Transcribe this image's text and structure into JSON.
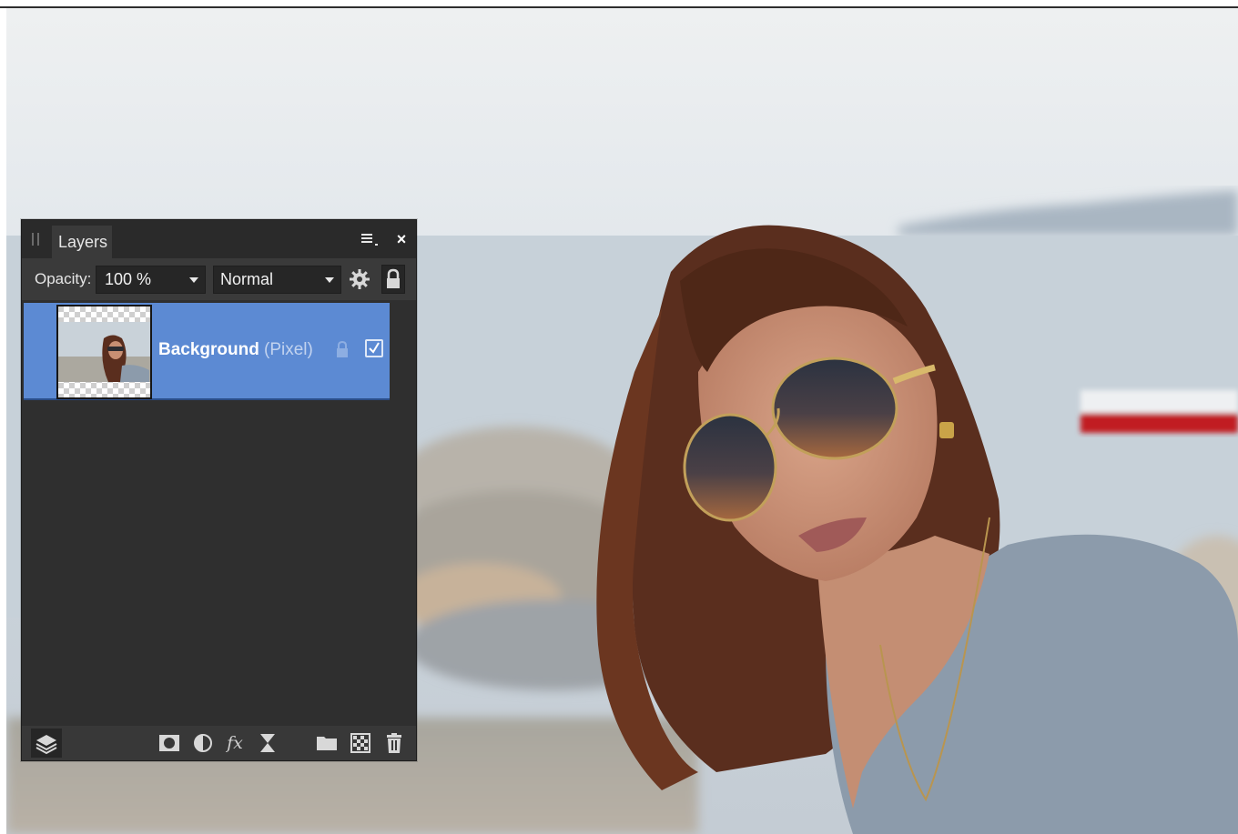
{
  "panel": {
    "tab_label": "Layers",
    "menu_icon": "panel-menu-icon",
    "close_label": "×",
    "opacity_label": "Opacity:",
    "opacity_value": "100 %",
    "blend_mode": "Normal"
  },
  "layers": [
    {
      "name": "Background",
      "type": "(Pixel)",
      "locked": false,
      "visible": true,
      "selected": true
    }
  ],
  "footer_icons": [
    "layers-stack-icon",
    "mask-icon",
    "adjustment-icon",
    "fx-icon",
    "live-filter-icon",
    "group-folder-icon",
    "pixel-layer-icon",
    "trash-icon"
  ],
  "footer": {
    "fx_label": "fx"
  },
  "colors": {
    "panel_bg": "#2f2f2f",
    "selection": "#5c8ad3",
    "tab_bg": "#3a3a3a"
  }
}
